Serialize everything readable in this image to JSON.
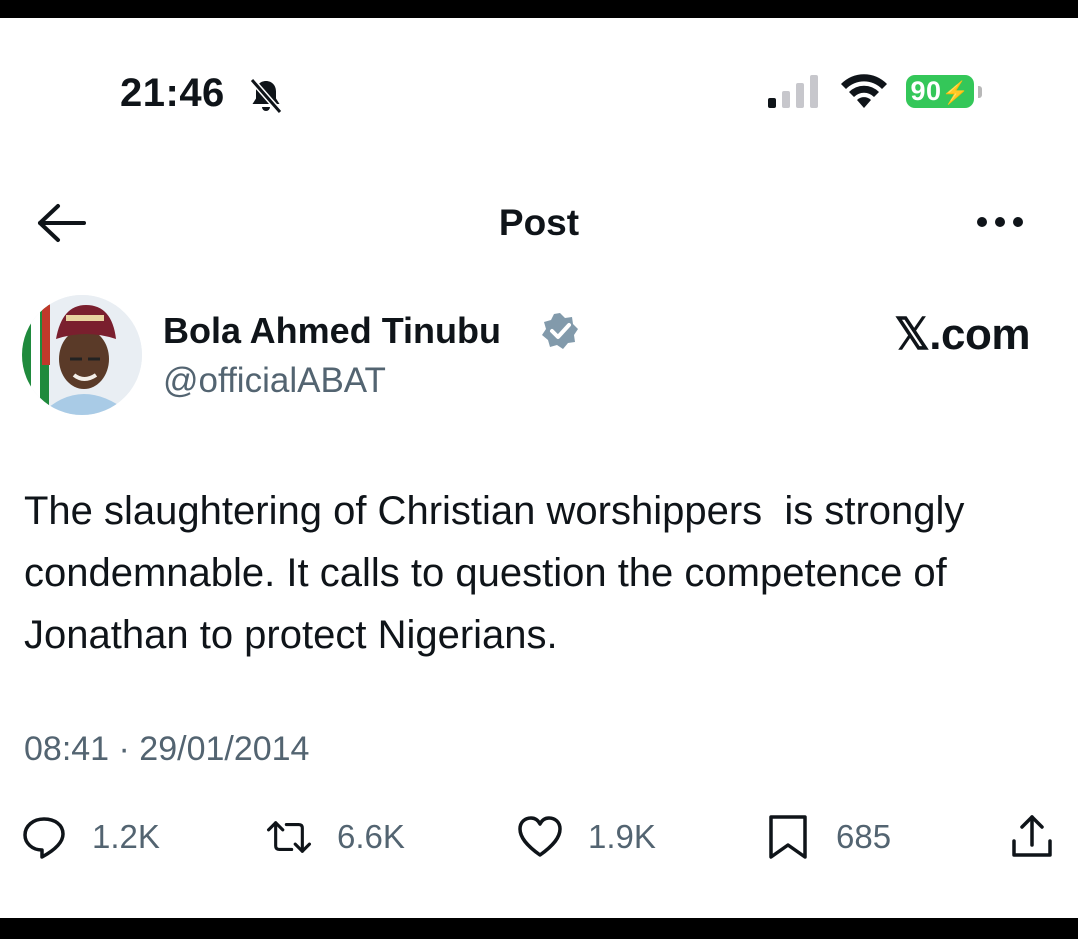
{
  "status_bar": {
    "time": "21:46",
    "battery": "90",
    "icons": [
      "bell-slash-icon",
      "signal-icon",
      "wifi-icon",
      "battery-charging-icon"
    ]
  },
  "header": {
    "title": "Post",
    "back_icon": "arrow-left-icon",
    "more_icon": "more-horizontal-icon"
  },
  "author": {
    "name": "Bola Ahmed Tinubu",
    "handle": "@officialABAT",
    "verified_icon": "verified-badge-icon",
    "verified_color": "#829aab"
  },
  "watermark": "𝕏.com",
  "tweet": {
    "text": "The slaughtering of Christian worshippers  is strongly condemnable. It calls to question the competence of Jonathan to protect Nigerians.",
    "timestamp": "08:41 · 29/01/2014"
  },
  "actions": {
    "replies": "1.2K",
    "reposts": "6.6K",
    "likes": "1.9K",
    "bookmarks": "685",
    "icons": [
      "reply-icon",
      "repost-icon",
      "like-icon",
      "bookmark-icon",
      "share-icon"
    ]
  },
  "colors": {
    "text": "#0f1419",
    "secondary": "#536471",
    "battery": "#34c759"
  }
}
